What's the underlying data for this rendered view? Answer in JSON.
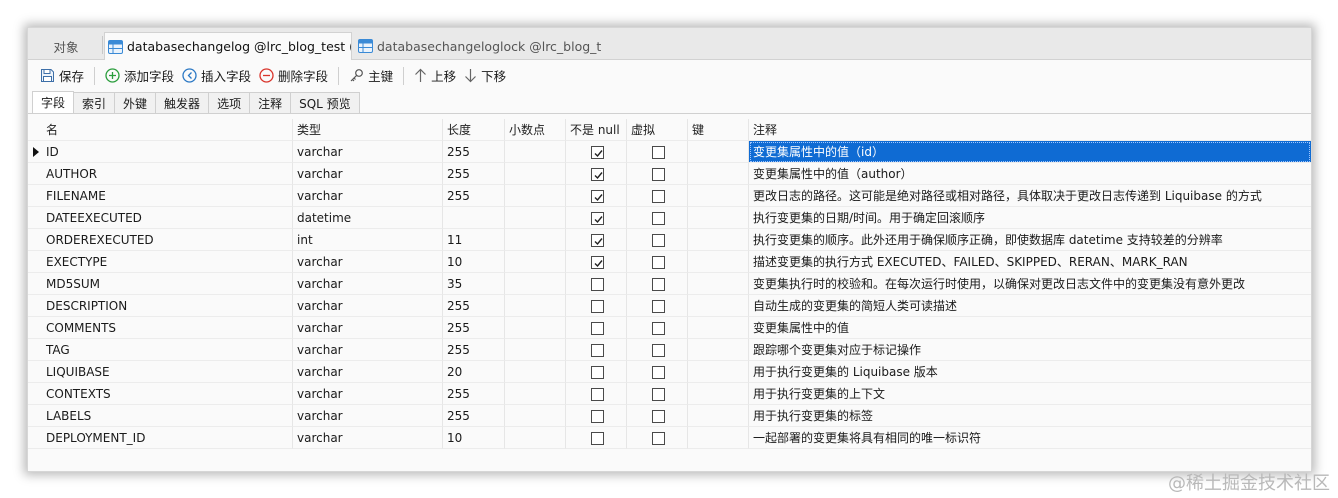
{
  "tabs": {
    "objects": "对象",
    "active": "databasechangelog @lrc_blog_test (...",
    "inactive": "databasechangeloglock @lrc_blog_t..."
  },
  "toolbar": {
    "save": "保存",
    "add_field": "添加字段",
    "insert_field": "插入字段",
    "delete_field": "删除字段",
    "primary_key": "主键",
    "move_up": "上移",
    "move_down": "下移"
  },
  "subtabs": [
    "字段",
    "索引",
    "外键",
    "触发器",
    "选项",
    "注释",
    "SQL 预览"
  ],
  "columns": {
    "name": "名",
    "type": "类型",
    "length": "长度",
    "decimal": "小数点",
    "not_null": "不是 null",
    "virtual": "虚拟",
    "key": "键",
    "comment": "注释"
  },
  "rows": [
    {
      "name": "ID",
      "type": "varchar",
      "length": "255",
      "not_null": true,
      "virtual": false,
      "comment": "变更集属性中的值（id）"
    },
    {
      "name": "AUTHOR",
      "type": "varchar",
      "length": "255",
      "not_null": true,
      "virtual": false,
      "comment": "变更集属性中的值（author）"
    },
    {
      "name": "FILENAME",
      "type": "varchar",
      "length": "255",
      "not_null": true,
      "virtual": false,
      "comment": "更改日志的路径。这可能是绝对路径或相对路径，具体取决于更改日志传递到 Liquibase 的方式"
    },
    {
      "name": "DATEEXECUTED",
      "type": "datetime",
      "length": "",
      "not_null": true,
      "virtual": false,
      "comment": "执行变更集的日期/时间。用于确定回滚顺序"
    },
    {
      "name": "ORDEREXECUTED",
      "type": "int",
      "length": "11",
      "not_null": true,
      "virtual": false,
      "comment": "执行变更集的顺序。此外还用于确保顺序正确，即使数据库 datetime 支持较差的分辨率"
    },
    {
      "name": "EXECTYPE",
      "type": "varchar",
      "length": "10",
      "not_null": true,
      "virtual": false,
      "comment": "描述变更集的执行方式 EXECUTED、FAILED、SKIPPED、RERAN、MARK_RAN"
    },
    {
      "name": "MD5SUM",
      "type": "varchar",
      "length": "35",
      "not_null": false,
      "virtual": false,
      "comment": "变更集执行时的校验和。在每次运行时使用，以确保对更改日志文件中的变更集没有意外更改"
    },
    {
      "name": "DESCRIPTION",
      "type": "varchar",
      "length": "255",
      "not_null": false,
      "virtual": false,
      "comment": "自动生成的变更集的简短人类可读描述"
    },
    {
      "name": "COMMENTS",
      "type": "varchar",
      "length": "255",
      "not_null": false,
      "virtual": false,
      "comment": "变更集属性中的值"
    },
    {
      "name": "TAG",
      "type": "varchar",
      "length": "255",
      "not_null": false,
      "virtual": false,
      "comment": "跟踪哪个变更集对应于标记操作"
    },
    {
      "name": "LIQUIBASE",
      "type": "varchar",
      "length": "20",
      "not_null": false,
      "virtual": false,
      "comment": "用于执行变更集的 Liquibase 版本"
    },
    {
      "name": "CONTEXTS",
      "type": "varchar",
      "length": "255",
      "not_null": false,
      "virtual": false,
      "comment": "用于执行变更集的上下文"
    },
    {
      "name": "LABELS",
      "type": "varchar",
      "length": "255",
      "not_null": false,
      "virtual": false,
      "comment": "用于执行变更集的标签"
    },
    {
      "name": "DEPLOYMENT_ID",
      "type": "varchar",
      "length": "10",
      "not_null": false,
      "virtual": false,
      "comment": "一起部署的变更集将具有相同的唯一标识符"
    }
  ],
  "watermark": "@稀土掘金技术社区",
  "colors": {
    "selection": "#0f6bd3",
    "add": "#2a9d3c",
    "delete": "#d9342b",
    "insert": "#2b78c4"
  }
}
